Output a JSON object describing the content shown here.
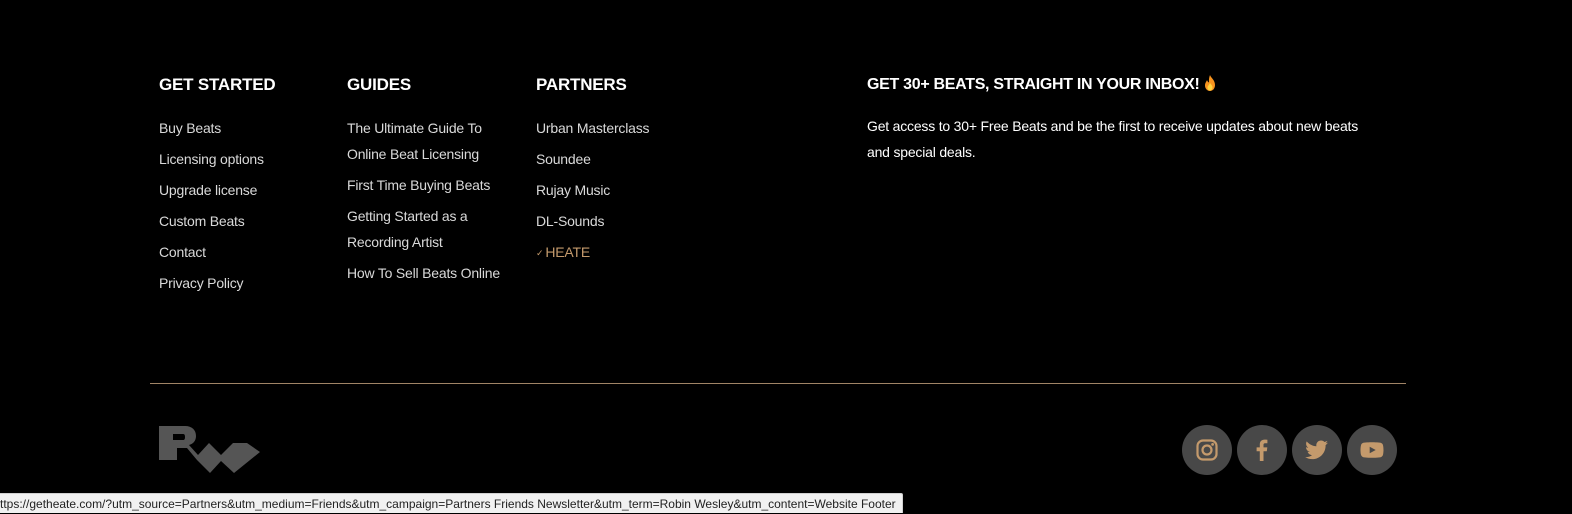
{
  "footer": {
    "get_started": {
      "heading": "GET STARTED",
      "links": [
        "Buy Beats",
        "Licensing options",
        "Upgrade license",
        "Custom Beats",
        "Contact",
        "Privacy Policy"
      ]
    },
    "guides": {
      "heading": "GUIDES",
      "links": [
        "The Ultimate Guide To Online Beat Licensing",
        "First Time Buying Beats",
        "Getting Started as a Recording Artist",
        "How To Sell Beats Online"
      ]
    },
    "partners": {
      "heading": "PARTNERS",
      "links": [
        "Urban Masterclass",
        "Soundee",
        "Rujay Music",
        "DL-Sounds",
        "HEATE"
      ]
    },
    "newsletter": {
      "heading": "GET 30+ BEATS, STRAIGHT IN YOUR INBOX!",
      "heading_icon": "fire-icon",
      "text": "Get access to 30+ Free Beats and be the first to receive updates about new beats and special deals."
    },
    "logo": "brand-logo",
    "socials": [
      "instagram-icon",
      "facebook-icon",
      "twitter-icon",
      "youtube-icon"
    ]
  },
  "status_bar": {
    "url": "ttps://getheate.com/?utm_source=Partners&utm_medium=Friends&utm_campaign=Partners Friends Newsletter&utm_term=Robin Wesley&utm_content=Website Footer"
  },
  "colors": {
    "background": "#000000",
    "accent": "#c49a6c",
    "divider": "#a08466",
    "social_bg": "#484848"
  }
}
